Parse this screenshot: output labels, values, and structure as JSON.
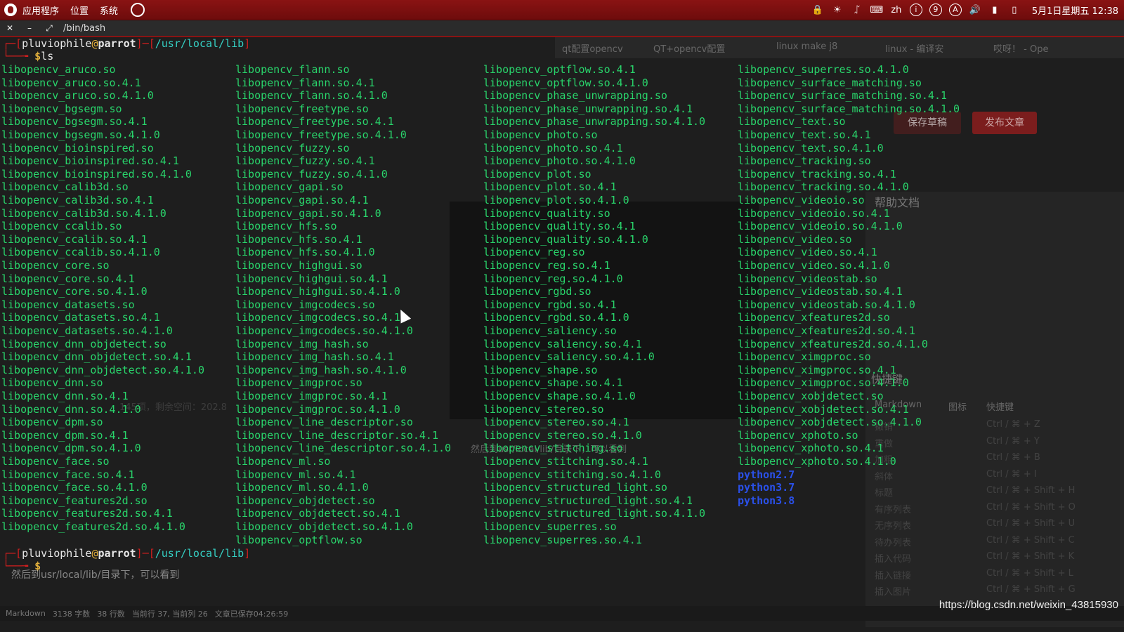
{
  "panel": {
    "menus": [
      "应用程序",
      "位置",
      "系统"
    ],
    "tray_icons": [
      "lock-icon",
      "brightness-icon",
      "bluetooth-icon",
      "keyboard-icon",
      "input-method",
      "info-icon",
      "badge-9-icon",
      "accessibility-icon",
      "volume-icon",
      "signal-icon",
      "battery-icon"
    ],
    "input_method": "zh",
    "badge_i": "i",
    "badge_9": "9",
    "badge_a": "A",
    "clock": "5月1日星期五 12:38"
  },
  "terminal": {
    "title": "/bin/bash",
    "prompt": {
      "frame_open": "┌─[",
      "user": "pluviophile",
      "at": "@",
      "host": "parrot",
      "sep": "]─[",
      "path": "/usr/local/lib",
      "frame_close": "]",
      "second_prefix": "└──╼ ",
      "dollar": "$",
      "command": "ls"
    },
    "columns": [
      [
        "libopencv_aruco.so",
        "libopencv_aruco.so.4.1",
        "libopencv_aruco.so.4.1.0",
        "libopencv_bgsegm.so",
        "libopencv_bgsegm.so.4.1",
        "libopencv_bgsegm.so.4.1.0",
        "libopencv_bioinspired.so",
        "libopencv_bioinspired.so.4.1",
        "libopencv_bioinspired.so.4.1.0",
        "libopencv_calib3d.so",
        "libopencv_calib3d.so.4.1",
        "libopencv_calib3d.so.4.1.0",
        "libopencv_ccalib.so",
        "libopencv_ccalib.so.4.1",
        "libopencv_ccalib.so.4.1.0",
        "libopencv_core.so",
        "libopencv_core.so.4.1",
        "libopencv_core.so.4.1.0",
        "libopencv_datasets.so",
        "libopencv_datasets.so.4.1",
        "libopencv_datasets.so.4.1.0",
        "libopencv_dnn_objdetect.so",
        "libopencv_dnn_objdetect.so.4.1",
        "libopencv_dnn_objdetect.so.4.1.0",
        "libopencv_dnn.so",
        "libopencv_dnn.so.4.1",
        "libopencv_dnn.so.4.1.0",
        "libopencv_dpm.so",
        "libopencv_dpm.so.4.1",
        "libopencv_dpm.so.4.1.0",
        "libopencv_face.so",
        "libopencv_face.so.4.1",
        "libopencv_face.so.4.1.0",
        "libopencv_features2d.so",
        "libopencv_features2d.so.4.1",
        "libopencv_features2d.so.4.1.0"
      ],
      [
        "libopencv_flann.so",
        "libopencv_flann.so.4.1",
        "libopencv_flann.so.4.1.0",
        "libopencv_freetype.so",
        "libopencv_freetype.so.4.1",
        "libopencv_freetype.so.4.1.0",
        "libopencv_fuzzy.so",
        "libopencv_fuzzy.so.4.1",
        "libopencv_fuzzy.so.4.1.0",
        "libopencv_gapi.so",
        "libopencv_gapi.so.4.1",
        "libopencv_gapi.so.4.1.0",
        "libopencv_hfs.so",
        "libopencv_hfs.so.4.1",
        "libopencv_hfs.so.4.1.0",
        "libopencv_highgui.so",
        "libopencv_highgui.so.4.1",
        "libopencv_highgui.so.4.1.0",
        "libopencv_imgcodecs.so",
        "libopencv_imgcodecs.so.4.1",
        "libopencv_imgcodecs.so.4.1.0",
        "libopencv_img_hash.so",
        "libopencv_img_hash.so.4.1",
        "libopencv_img_hash.so.4.1.0",
        "libopencv_imgproc.so",
        "libopencv_imgproc.so.4.1",
        "libopencv_imgproc.so.4.1.0",
        "libopencv_line_descriptor.so",
        "libopencv_line_descriptor.so.4.1",
        "libopencv_line_descriptor.so.4.1.0",
        "libopencv_ml.so",
        "libopencv_ml.so.4.1",
        "libopencv_ml.so.4.1.0",
        "libopencv_objdetect.so",
        "libopencv_objdetect.so.4.1",
        "libopencv_objdetect.so.4.1.0",
        "libopencv_optflow.so"
      ],
      [
        "libopencv_optflow.so.4.1",
        "libopencv_optflow.so.4.1.0",
        "libopencv_phase_unwrapping.so",
        "libopencv_phase_unwrapping.so.4.1",
        "libopencv_phase_unwrapping.so.4.1.0",
        "libopencv_photo.so",
        "libopencv_photo.so.4.1",
        "libopencv_photo.so.4.1.0",
        "libopencv_plot.so",
        "libopencv_plot.so.4.1",
        "libopencv_plot.so.4.1.0",
        "libopencv_quality.so",
        "libopencv_quality.so.4.1",
        "libopencv_quality.so.4.1.0",
        "libopencv_reg.so",
        "libopencv_reg.so.4.1",
        "libopencv_reg.so.4.1.0",
        "libopencv_rgbd.so",
        "libopencv_rgbd.so.4.1",
        "libopencv_rgbd.so.4.1.0",
        "libopencv_saliency.so",
        "libopencv_saliency.so.4.1",
        "libopencv_saliency.so.4.1.0",
        "libopencv_shape.so",
        "libopencv_shape.so.4.1",
        "libopencv_shape.so.4.1.0",
        "libopencv_stereo.so",
        "libopencv_stereo.so.4.1",
        "libopencv_stereo.so.4.1.0",
        "libopencv_stitching.so",
        "libopencv_stitching.so.4.1",
        "libopencv_stitching.so.4.1.0",
        "libopencv_structured_light.so",
        "libopencv_structured_light.so.4.1",
        "libopencv_structured_light.so.4.1.0",
        "libopencv_superres.so",
        "libopencv_superres.so.4.1"
      ],
      [
        "libopencv_superres.so.4.1.0",
        "libopencv_surface_matching.so",
        "libopencv_surface_matching.so.4.1",
        "libopencv_surface_matching.so.4.1.0",
        "libopencv_text.so",
        "libopencv_text.so.4.1",
        "libopencv_text.so.4.1.0",
        "libopencv_tracking.so",
        "libopencv_tracking.so.4.1",
        "libopencv_tracking.so.4.1.0",
        "libopencv_videoio.so",
        "libopencv_videoio.so.4.1",
        "libopencv_videoio.so.4.1.0",
        "libopencv_video.so",
        "libopencv_video.so.4.1",
        "libopencv_video.so.4.1.0",
        "libopencv_videostab.so",
        "libopencv_videostab.so.4.1",
        "libopencv_videostab.so.4.1.0",
        "libopencv_xfeatures2d.so",
        "libopencv_xfeatures2d.so.4.1",
        "libopencv_xfeatures2d.so.4.1.0",
        "libopencv_ximgproc.so",
        "libopencv_ximgproc.so.4.1",
        "libopencv_ximgproc.so.4.1.0",
        "libopencv_xobjdetect.so",
        "libopencv_xobjdetect.so.4.1",
        "libopencv_xobjdetect.so.4.1.0",
        "libopencv_xphoto.so",
        "libopencv_xphoto.so.4.1",
        "libopencv_xphoto.so.4.1.0"
      ]
    ],
    "dirs": [
      "python2.7",
      "python3.7",
      "python3.8"
    ]
  },
  "background": {
    "tabs": [
      "qt配置opencv",
      "QT+opencv配置",
      "linux make j8",
      "linux - 编译安",
      "哎呀！ - Ope"
    ],
    "save_draft": "保存草稿",
    "publish": "发布文章",
    "help_title": "帮助文档",
    "shortcut_title": "快捷键",
    "markdown_header": "Markdown",
    "icon_header": "图标",
    "shortcut_header": "快捷键",
    "shortcuts": [
      [
        "撤销",
        "Ctrl / ⌘ + Z"
      ],
      [
        "重做",
        "Ctrl / ⌘ + Y"
      ],
      [
        "加粗",
        "Ctrl / ⌘ + B"
      ],
      [
        "斜体",
        "Ctrl / ⌘ + I"
      ],
      [
        "标题",
        "Ctrl / ⌘ + Shift + H"
      ],
      [
        "有序列表",
        "Ctrl / ⌘ + Shift + O"
      ],
      [
        "无序列表",
        "Ctrl / ⌘ + Shift + U"
      ],
      [
        "待办列表",
        "Ctrl / ⌘ + Shift + C"
      ],
      [
        "插入代码",
        "Ctrl / ⌘ + Shift + K"
      ],
      [
        "插入链接",
        "Ctrl / ⌘ + Shift + L"
      ],
      [
        "插入图片",
        "Ctrl / ⌘ + Shift + G"
      ]
    ],
    "caption": "然后到usr/local/lib/目录下，可以看到",
    "status": [
      "Markdown",
      "3138 字数",
      "38 行数",
      "当前行 37, 当前列 26",
      "文章已保存04:26:59"
    ],
    "free_space": "145项，剩余空间：202.8"
  },
  "watermark_url": "https://blog.csdn.net/weixin_43815930"
}
